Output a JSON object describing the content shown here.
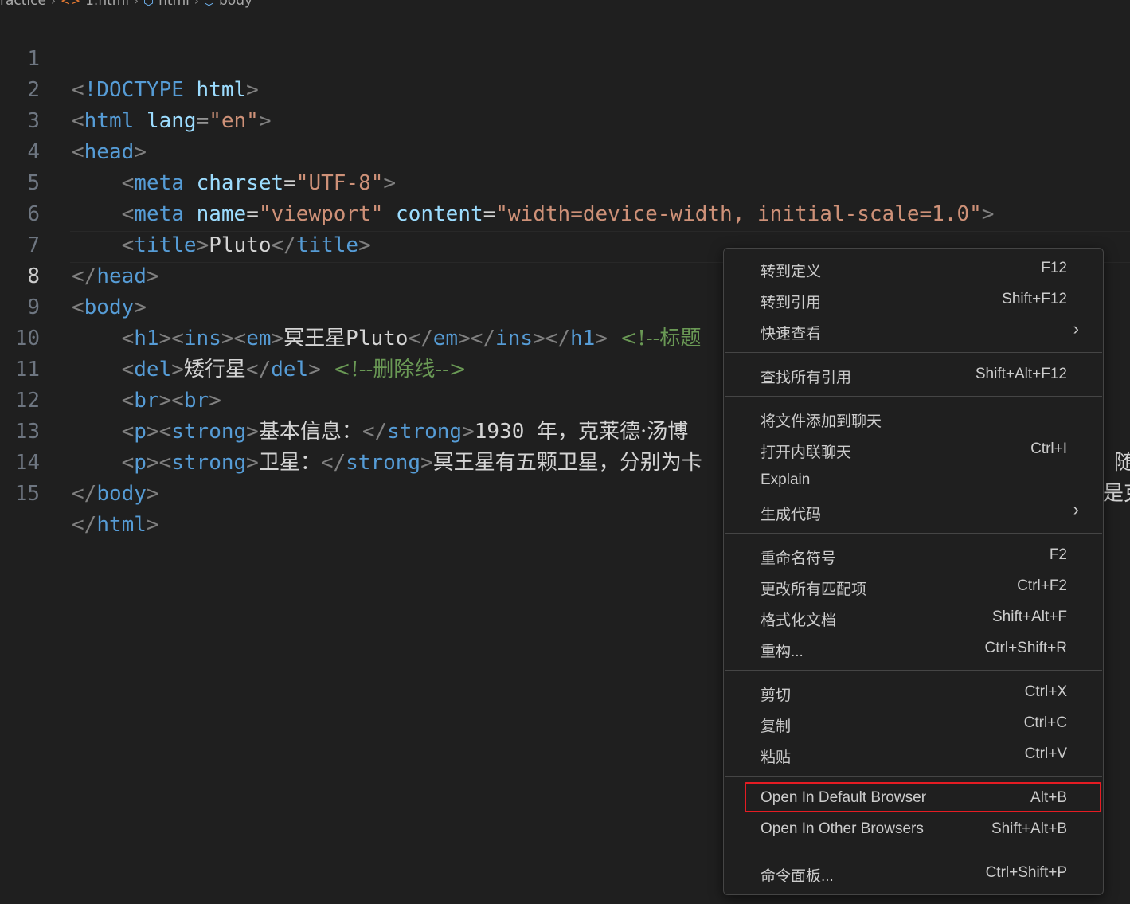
{
  "breadcrumb": {
    "folder": "ractice",
    "file": "1.html",
    "node1": "html",
    "node2": "body",
    "file_icon": "html-file-icon",
    "node_icon": "symbol-node-icon"
  },
  "lines": [
    {
      "n": "1"
    },
    {
      "n": "2"
    },
    {
      "n": "3"
    },
    {
      "n": "4"
    },
    {
      "n": "5"
    },
    {
      "n": "6"
    },
    {
      "n": "7"
    },
    {
      "n": "8"
    },
    {
      "n": "9"
    },
    {
      "n": "10"
    },
    {
      "n": "11"
    },
    {
      "n": "12"
    },
    {
      "n": "13"
    },
    {
      "n": "14"
    },
    {
      "n": "15"
    }
  ],
  "code": {
    "l1_doctype": "!DOCTYPE",
    "l1_html": "html",
    "l2_tag": "html",
    "l2_attr": "lang",
    "l2_val": "\"en\"",
    "l3_tag": "head",
    "l4_tag": "meta",
    "l4_attr": "charset",
    "l4_val": "\"UTF-8\"",
    "l5_tag": "meta",
    "l5_attr1": "name",
    "l5_val1": "\"viewport\"",
    "l5_attr2": "content",
    "l5_val2": "\"width=device-width, initial-scale=1.0\"",
    "l6_tag": "title",
    "l6_text": "Pluto",
    "l7_tag": "head",
    "l8_tag": "body",
    "l9_h1": "h1",
    "l9_ins": "ins",
    "l9_em": "em",
    "l9_text_cjk": "冥王星",
    "l9_text": "Pluto",
    "l9_comment": "<!--标题",
    "l10_tag": "del",
    "l10_text": "矮行星",
    "l10_comment": "<!--删除线-->",
    "l11_tag": "br",
    "l12_p": "p",
    "l12_strong": "strong",
    "l12_text1": "基本信息：",
    "l12_num": "1930",
    "l12_text2": "年，克莱德·汤博",
    "l12_tail": "随",
    "l13_p": "p",
    "l13_strong": "strong",
    "l13_text1": "卫星：",
    "l13_text2": "冥王星有五颗卫星，分别为卡",
    "l13_tail": "是克",
    "l14_tag": "body",
    "l15_tag": "html"
  },
  "menu": {
    "items": [
      {
        "label": "转到定义",
        "key": "F12"
      },
      {
        "label": "转到引用",
        "key": "Shift+F12"
      },
      {
        "label": "快速查看",
        "key": ""
      },
      {
        "label": "查找所有引用",
        "key": "Shift+Alt+F12"
      },
      {
        "label": "将文件添加到聊天",
        "key": ""
      },
      {
        "label": "打开内联聊天",
        "key": "Ctrl+I"
      },
      {
        "label": "Explain",
        "key": ""
      },
      {
        "label": "生成代码",
        "key": ""
      },
      {
        "label": "重命名符号",
        "key": "F2"
      },
      {
        "label": "更改所有匹配项",
        "key": "Ctrl+F2"
      },
      {
        "label": "格式化文档",
        "key": "Shift+Alt+F"
      },
      {
        "label": "重构...",
        "key": "Ctrl+Shift+R"
      },
      {
        "label": "剪切",
        "key": "Ctrl+X"
      },
      {
        "label": "复制",
        "key": "Ctrl+C"
      },
      {
        "label": "粘贴",
        "key": "Ctrl+V"
      },
      {
        "label": "Open In Default Browser",
        "key": "Alt+B"
      },
      {
        "label": "Open In Other Browsers",
        "key": "Shift+Alt+B"
      },
      {
        "label": "命令面板...",
        "key": "Ctrl+Shift+P"
      }
    ],
    "submenu_icon": "chevron-right-icon",
    "highlight_color": "#e51c23"
  }
}
